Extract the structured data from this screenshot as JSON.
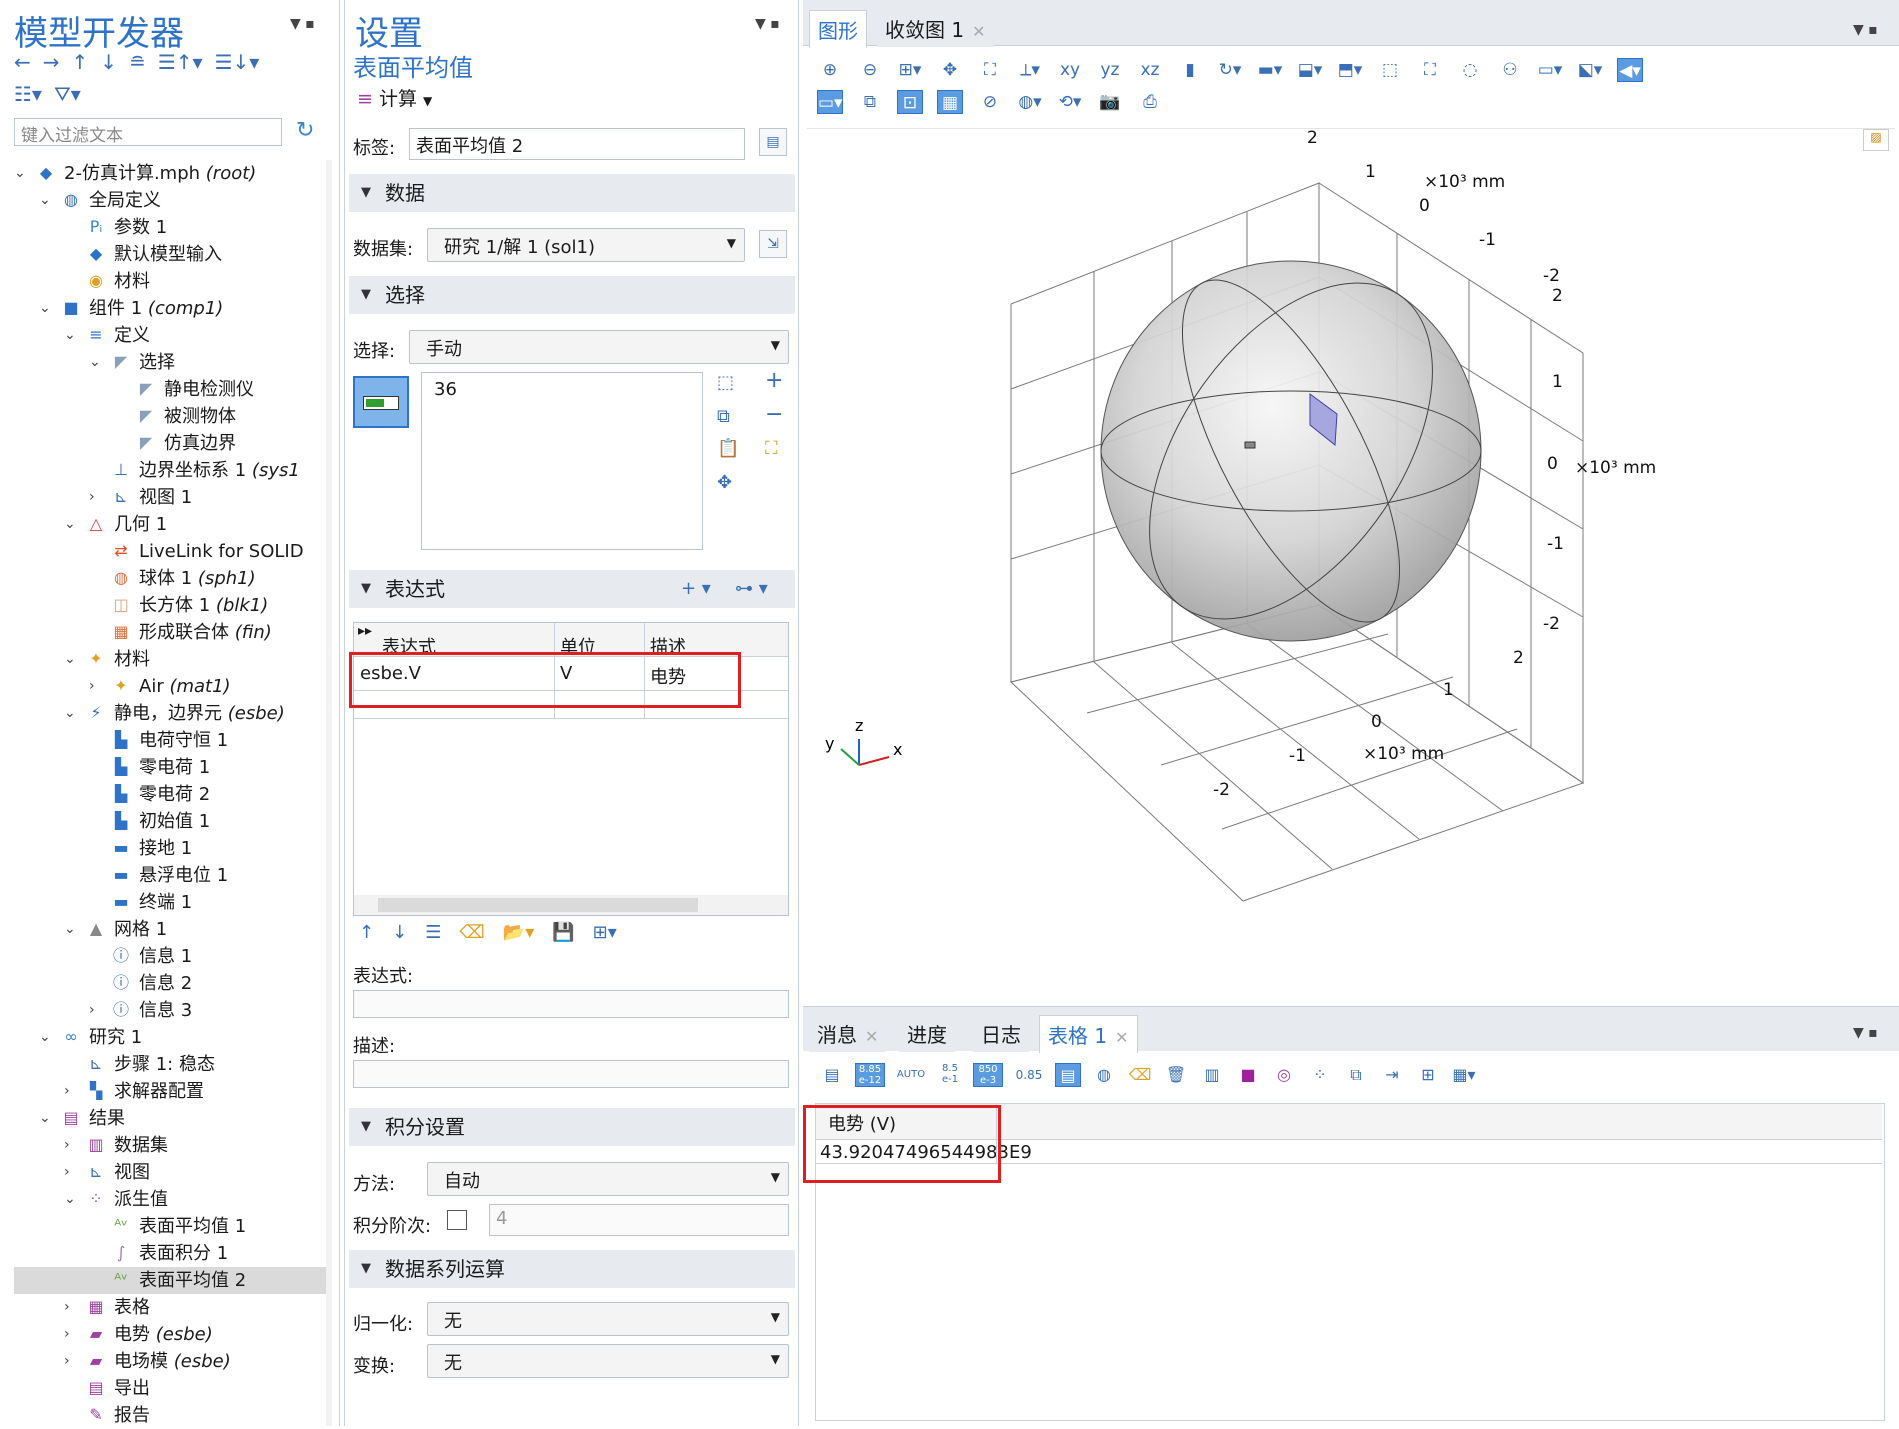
{
  "left_panel": {
    "title": "模型开发器",
    "filter_placeholder": "键入过滤文本",
    "tree": [
      {
        "label": "2-仿真计算.mph",
        "tag": "(root)"
      },
      {
        "label": "全局定义",
        "tag": ""
      },
      {
        "label": "参数 1",
        "tag": ""
      },
      {
        "label": "默认模型输入",
        "tag": ""
      },
      {
        "label": "材料",
        "tag": ""
      },
      {
        "label": "组件 1",
        "tag": "(comp1)"
      },
      {
        "label": "定义",
        "tag": ""
      },
      {
        "label": "选择",
        "tag": ""
      },
      {
        "label": "静电检测仪",
        "tag": ""
      },
      {
        "label": "被测物体",
        "tag": ""
      },
      {
        "label": "仿真边界",
        "tag": ""
      },
      {
        "label": "边界坐标系 1",
        "tag": "(sys1"
      },
      {
        "label": "视图 1",
        "tag": ""
      },
      {
        "label": "几何 1",
        "tag": ""
      },
      {
        "label": "LiveLink for SOLID",
        "tag": ""
      },
      {
        "label": "球体 1",
        "tag": "(sph1)"
      },
      {
        "label": "长方体 1",
        "tag": "(blk1)"
      },
      {
        "label": "形成联合体",
        "tag": "(fin)"
      },
      {
        "label": "材料",
        "tag": ""
      },
      {
        "label": "Air",
        "tag": "(mat1)"
      },
      {
        "label": "静电，边界元",
        "tag": "(esbe)"
      },
      {
        "label": "电荷守恒 1",
        "tag": ""
      },
      {
        "label": "零电荷 1",
        "tag": ""
      },
      {
        "label": "零电荷 2",
        "tag": ""
      },
      {
        "label": "初始值 1",
        "tag": ""
      },
      {
        "label": "接地 1",
        "tag": ""
      },
      {
        "label": "悬浮电位 1",
        "tag": ""
      },
      {
        "label": "终端 1",
        "tag": ""
      },
      {
        "label": "网格 1",
        "tag": ""
      },
      {
        "label": "信息 1",
        "tag": ""
      },
      {
        "label": "信息 2",
        "tag": ""
      },
      {
        "label": "信息 3",
        "tag": ""
      },
      {
        "label": "研究 1",
        "tag": ""
      },
      {
        "label": "步骤 1: 稳态",
        "tag": ""
      },
      {
        "label": "求解器配置",
        "tag": ""
      },
      {
        "label": "结果",
        "tag": ""
      },
      {
        "label": "数据集",
        "tag": ""
      },
      {
        "label": "视图",
        "tag": ""
      },
      {
        "label": "派生值",
        "tag": ""
      },
      {
        "label": "表面平均值 1",
        "tag": ""
      },
      {
        "label": "表面积分 1",
        "tag": ""
      },
      {
        "label": "表面平均值 2",
        "tag": ""
      },
      {
        "label": "表格",
        "tag": ""
      },
      {
        "label": "电势",
        "tag": "(esbe)"
      },
      {
        "label": "电场模",
        "tag": "(esbe)"
      },
      {
        "label": "导出",
        "tag": ""
      },
      {
        "label": "报告",
        "tag": ""
      }
    ]
  },
  "settings": {
    "title": "设置",
    "subtitle": "表面平均值",
    "compute_label": "计算",
    "label_caption": "标签:",
    "label_value": "表面平均值 2",
    "sec_data": "数据",
    "dataset_caption": "数据集:",
    "dataset_value": "研究 1/解 1 (sol1)",
    "sec_selection": "选择",
    "selection_caption": "选择:",
    "selection_value": "手动",
    "selection_item": "36",
    "sec_expr": "表达式",
    "col_expr": "表达式",
    "col_unit": "单位",
    "col_desc": "描述",
    "row_expr": "esbe.V",
    "row_unit": "V",
    "row_desc": "电势",
    "expr_caption": "表达式:",
    "desc_caption": "描述:",
    "sec_integration": "积分设置",
    "method_caption": "方法:",
    "method_value": "自动",
    "order_caption": "积分阶次:",
    "order_value": "4",
    "sec_series": "数据系列运算",
    "norm_caption": "归一化:",
    "norm_value": "无",
    "transform_caption": "变换:",
    "transform_value": "无"
  },
  "graphics": {
    "tab_graphics": "图形",
    "tab_converge": "收敛图 1",
    "unit_label": "×10³ mm",
    "axis_z_ticks": [
      "2",
      "1",
      "0",
      "-1",
      "-2"
    ],
    "axis_right_ticks": [
      "2",
      "1",
      "0",
      "-1",
      "-2"
    ],
    "axis_bottom_ticks": [
      "2",
      "1",
      "0",
      "-1",
      "-2"
    ],
    "axis_top_ticks": [
      "2",
      "1",
      "0",
      "-1",
      "-2"
    ],
    "triad": {
      "x": "x",
      "y": "y",
      "z": "z"
    }
  },
  "bottom": {
    "tab_messages": "消息",
    "tab_progress": "进度",
    "tab_log": "日志",
    "tab_table": "表格 1",
    "col_header": "电势 (V)",
    "value": "43.92047496544983E9",
    "fmt_a": "8.85 e-12",
    "fmt_auto": "AUTO",
    "fmt_b": "8.5 e-1",
    "fmt_c": "850 e-3",
    "fmt_d": "0.85"
  }
}
